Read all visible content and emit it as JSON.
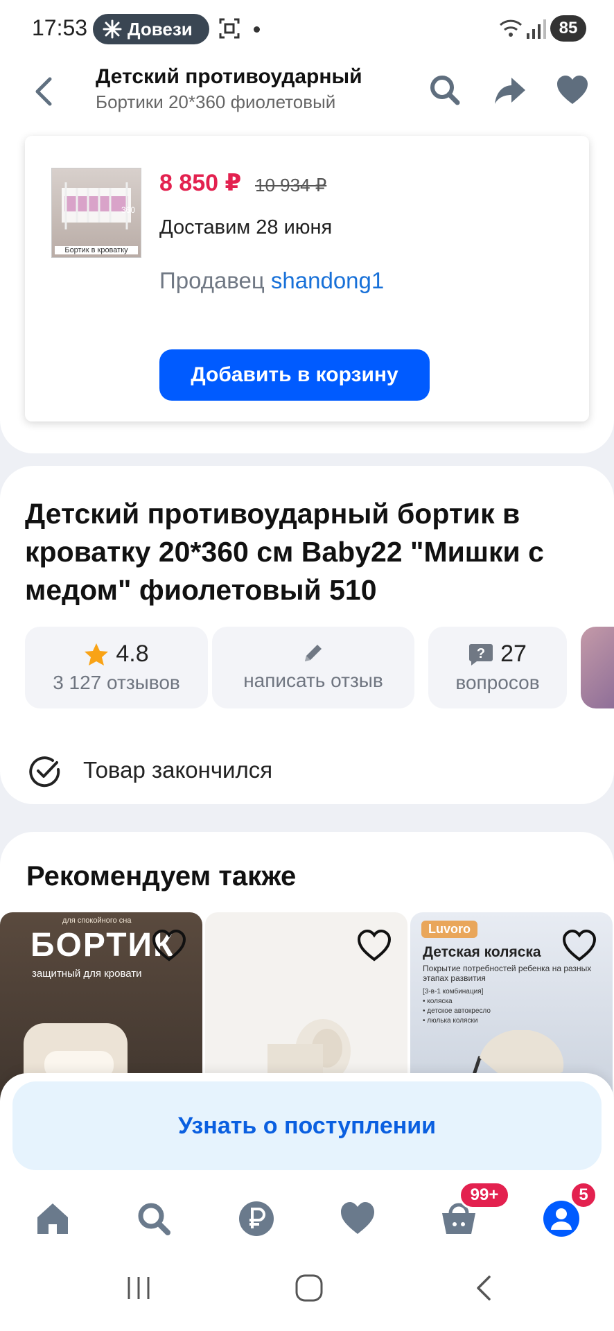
{
  "status_bar": {
    "time": "17:53",
    "pill_label": "Довези",
    "battery": "85"
  },
  "header": {
    "title": "Детский противоударный",
    "subtitle": "Бортики 20*360 фиолетовый"
  },
  "product_card": {
    "thumb_caption": "Бортик в кроватку",
    "price": "8 850 ₽",
    "old_price": "10 934 ₽",
    "delivery": "Доставим 28 июня",
    "seller_label": "Продавец",
    "seller_name": "shandong1",
    "add_to_cart": "Добавить в корзину"
  },
  "product": {
    "title": "Детский противоударный бортик в кроватку 20*360 см Baby22 \"Мишки с медом\" фиолетовый 510",
    "rating": "4.8",
    "reviews": "3 127 отзывов",
    "write_review": "написать отзыв",
    "questions_count": "27",
    "questions_label": "вопросов",
    "availability": "Товар закончился"
  },
  "recommendations": {
    "title": "Рекомендуем также",
    "cards": [
      {
        "top": "для спокойного сна",
        "headline": "БОРТИК",
        "sub": "защитный   для кровати"
      },
      {},
      {
        "brand": "Luvoro",
        "headline": "Детская коляска",
        "desc": "Покрытие потребностей ребенка на разных этапах развития",
        "list": [
          "[3-в-1 комбинация]",
          "• коляска",
          "• детское автокресло",
          "• люлька коляски"
        ]
      }
    ]
  },
  "notify_button": "Узнать о поступлении",
  "bottom_nav": {
    "cart_badge": "99+",
    "profile_badge": "5"
  },
  "colors": {
    "accent_blue": "#005bff",
    "price_red": "#e3214f",
    "link_blue": "#1770d8",
    "notify_bg": "#e6f3fd"
  }
}
